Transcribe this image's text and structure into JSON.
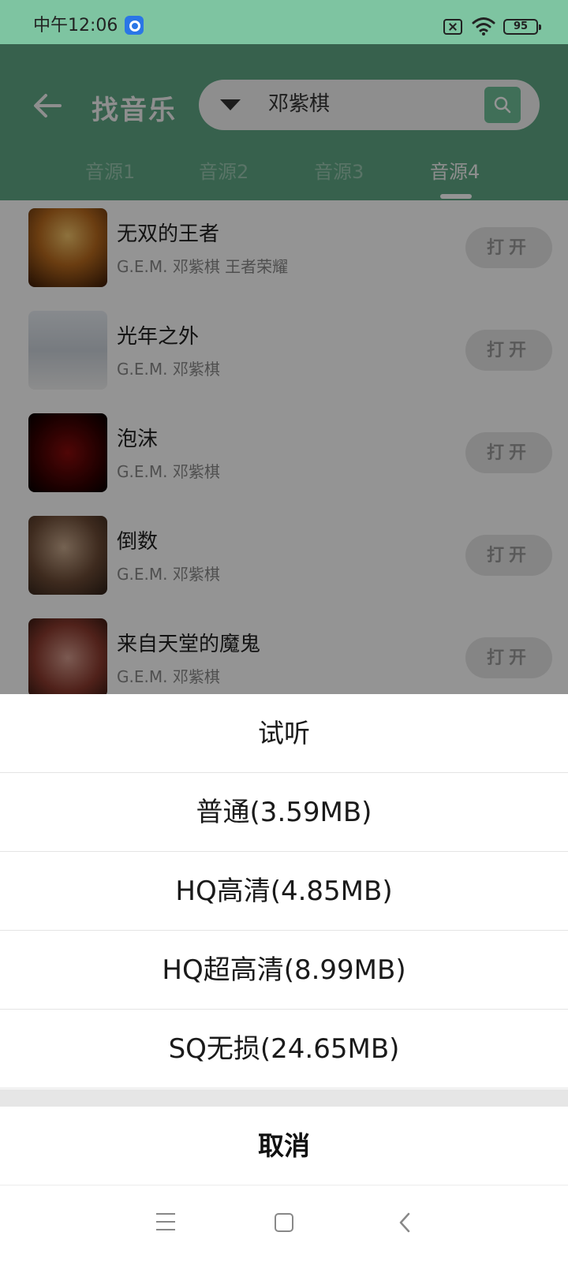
{
  "status_bar": {
    "time": "中午12:06",
    "battery": "95"
  },
  "header": {
    "title": "找音乐",
    "search_value": "邓紫棋",
    "tabs": [
      "音源1",
      "音源2",
      "音源3",
      "音源4"
    ]
  },
  "songs": [
    {
      "title": "无双的王者",
      "artist": "G.E.M. 邓紫棋 王者荣耀",
      "action": "打开"
    },
    {
      "title": "光年之外",
      "artist": "G.E.M. 邓紫棋",
      "action": "打开"
    },
    {
      "title": "泡沫",
      "artist": "G.E.M. 邓紫棋",
      "action": "打开"
    },
    {
      "title": "倒数",
      "artist": "G.E.M. 邓紫棋",
      "action": "打开"
    },
    {
      "title": "来自天堂的魔鬼",
      "artist": "G.E.M. 邓紫棋",
      "action": "打开"
    }
  ],
  "sheet": {
    "options": [
      "试听",
      "普通(3.59MB)",
      "HQ高清(4.85MB)",
      "HQ超高清(8.99MB)",
      "SQ无损(24.65MB)"
    ],
    "cancel": "取消"
  },
  "colors": {
    "accent": "#6fbf98",
    "status_bar": "#7ec4a1"
  }
}
